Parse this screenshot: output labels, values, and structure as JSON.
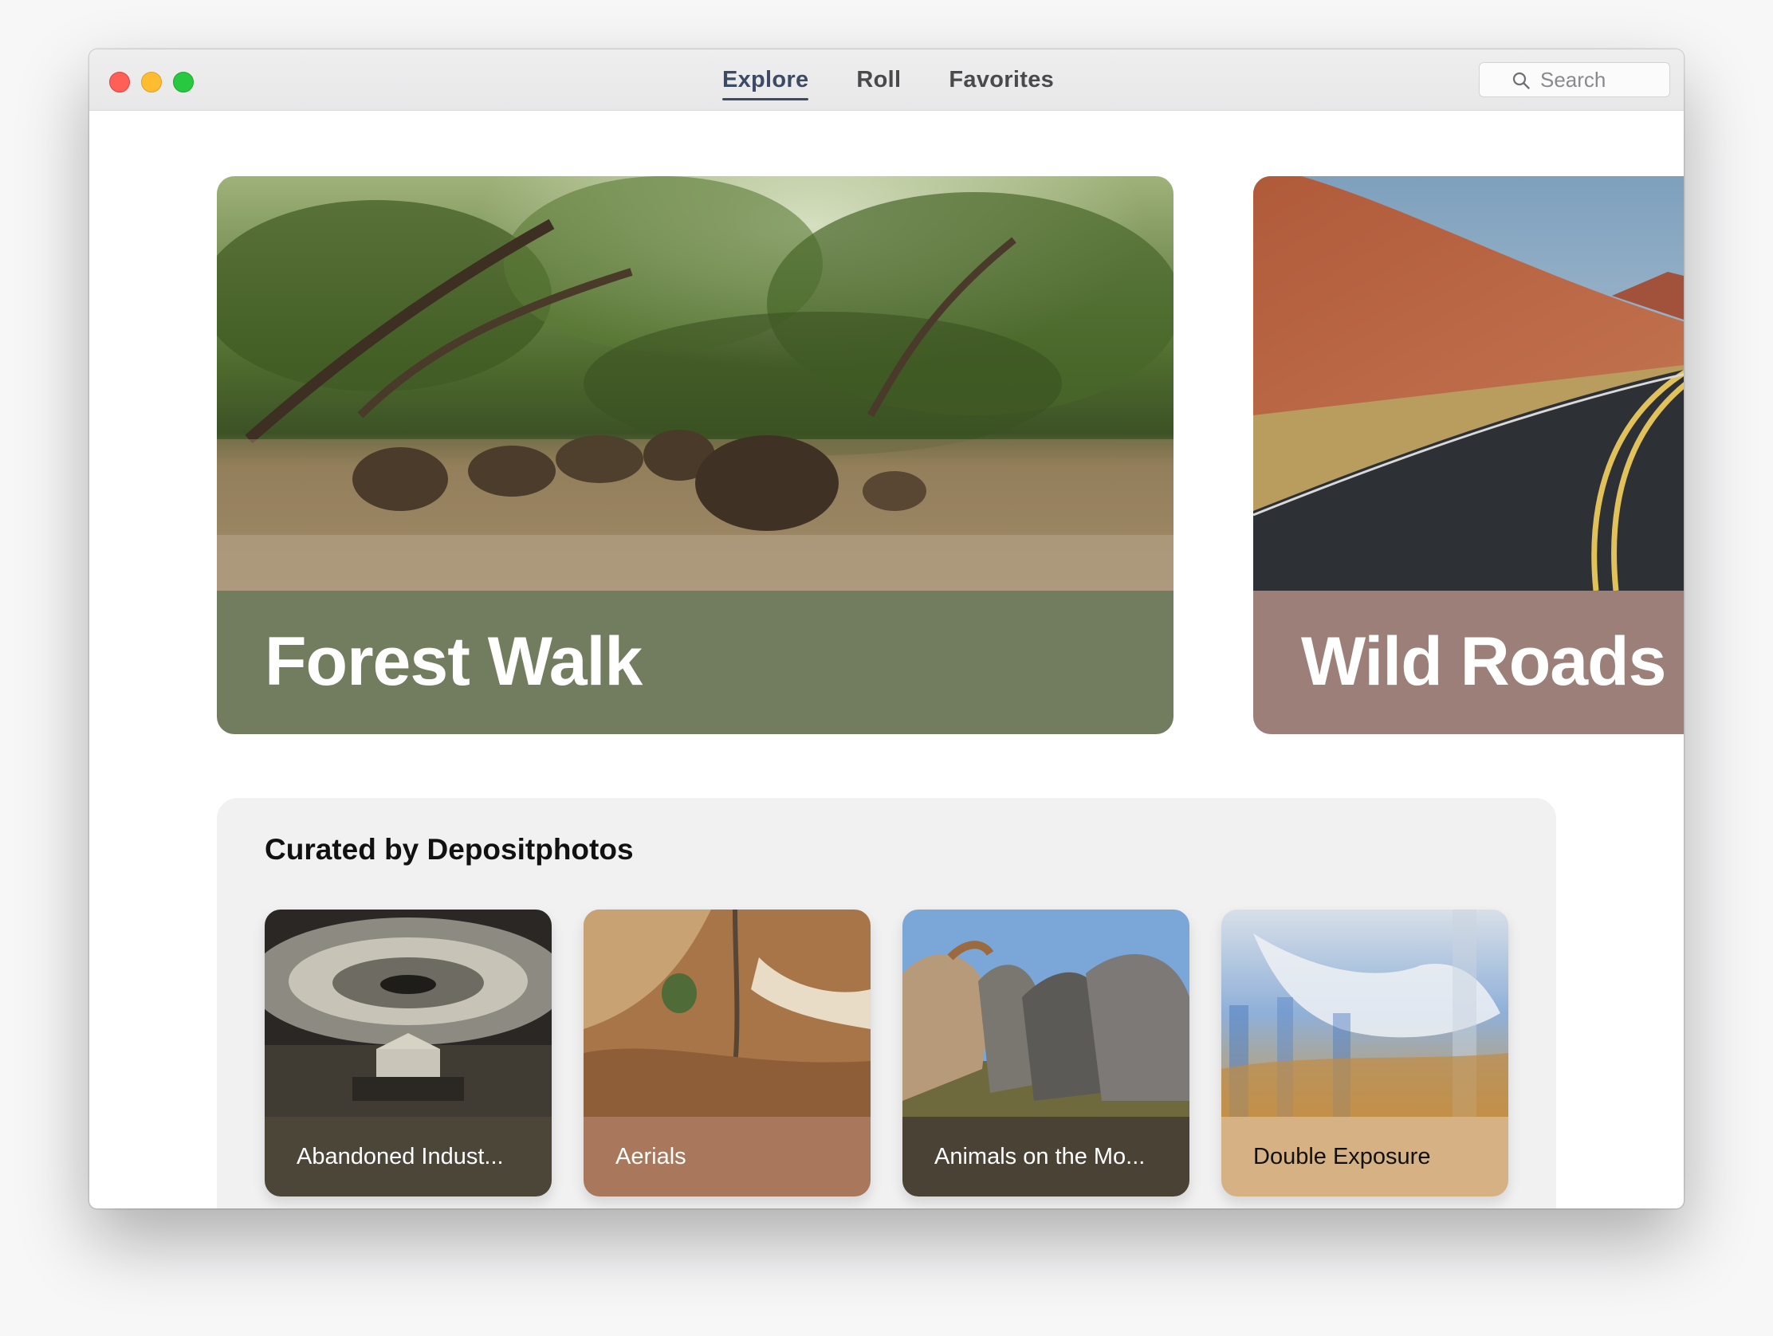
{
  "window": {
    "traffic_lights": [
      "close",
      "minimize",
      "zoom"
    ]
  },
  "tabs": [
    {
      "label": "Explore",
      "active": true
    },
    {
      "label": "Roll",
      "active": false
    },
    {
      "label": "Favorites",
      "active": false
    }
  ],
  "search": {
    "placeholder": "Search",
    "icon": "search-icon"
  },
  "featured": [
    {
      "title": "Forest Walk",
      "band_color": "#727c5e"
    },
    {
      "title": "Wild Roads",
      "band_color": "#9b7f78"
    }
  ],
  "curated": {
    "title": "Curated by Depositphotos",
    "cards": [
      {
        "label": "Abandoned Indust...",
        "band_color": "#4b4637",
        "text_color": "#ffffff"
      },
      {
        "label": "Aerials",
        "band_color": "#a9775b",
        "text_color": "#ffffff"
      },
      {
        "label": "Animals on the Mo...",
        "band_color": "#4a4335",
        "text_color": "#ffffff"
      },
      {
        "label": "Double Exposure",
        "band_color": "#d6b184",
        "text_color": "#111111"
      }
    ]
  }
}
